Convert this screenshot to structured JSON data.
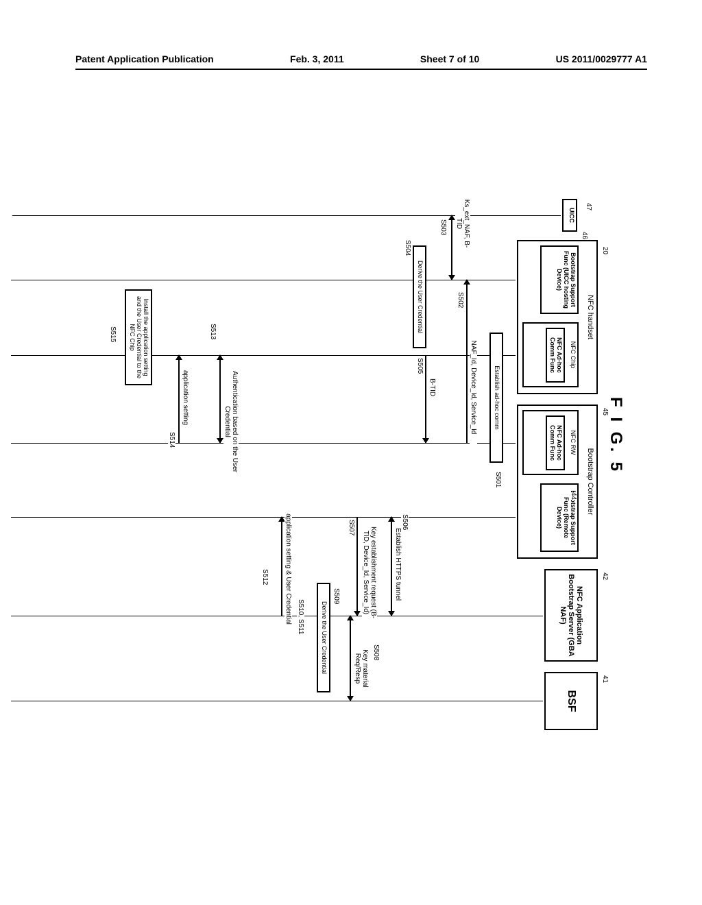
{
  "header": {
    "left": "Patent Application Publication",
    "center": "Feb. 3, 2011",
    "sheet": "Sheet 7 of 10",
    "right": "US 2011/0029777 A1"
  },
  "figure": {
    "title": "F I G.  5"
  },
  "lanes": {
    "uicc": {
      "label": "UICC",
      "num": "47"
    },
    "handset": {
      "label": "NFC handset",
      "num": "20",
      "bsf46_num": "46",
      "bsf46": "Bootstrap Support Func (UICC hosting Device)",
      "nfcchip": "NFC Chip",
      "nfcfunc": "NFC Ad-hoc Comm Func"
    },
    "controller": {
      "label": "Bootstrap Controller",
      "num": "45",
      "rw": "NFC RW",
      "rwfunc": "NFC Ad-hoc Comm Func",
      "remote": "Bootstrap Support Func (Remote Device)",
      "remote_num": "44"
    },
    "naf": {
      "label": "NFC Application Bootstrap Server (GBA NAF)",
      "num": "42"
    },
    "bsf": {
      "label": "BSF",
      "num": "41"
    }
  },
  "messages": {
    "s501": {
      "step": "S501",
      "text": "Establish ad-hoc comm"
    },
    "s502": {
      "step": "S502",
      "text": "NAF_Id, Device_Id, Service_Id"
    },
    "s503": {
      "step": "S503",
      "text": "Ks_ext_NAF, B-TID"
    },
    "s504": {
      "step": "S504",
      "text": "Derive the User Credential"
    },
    "s505": {
      "step": "S505",
      "text": "B-TID"
    },
    "s506": {
      "step": "S506",
      "text": "Establish HTTPS tunnel"
    },
    "s507": {
      "step": "S507",
      "text": "Key establishment request (B-TID, Device_Id, Service_Id)"
    },
    "s508": {
      "step": "S508",
      "text": "Key material Req/Resp"
    },
    "s509": {
      "step": "S509",
      "text": "Derive the User Credential"
    },
    "s510_511": {
      "step": "S510, S511",
      "text": "application setting & User Credential"
    },
    "s512": {
      "step": "S512"
    },
    "s513": {
      "step": "S513",
      "text": "Authentication based on the User Credential"
    },
    "s514": {
      "step": "S514",
      "text": "application setting"
    },
    "s515": {
      "step": "S515",
      "text": "Install the application setting and the User Credential to the NFC Chip"
    }
  }
}
